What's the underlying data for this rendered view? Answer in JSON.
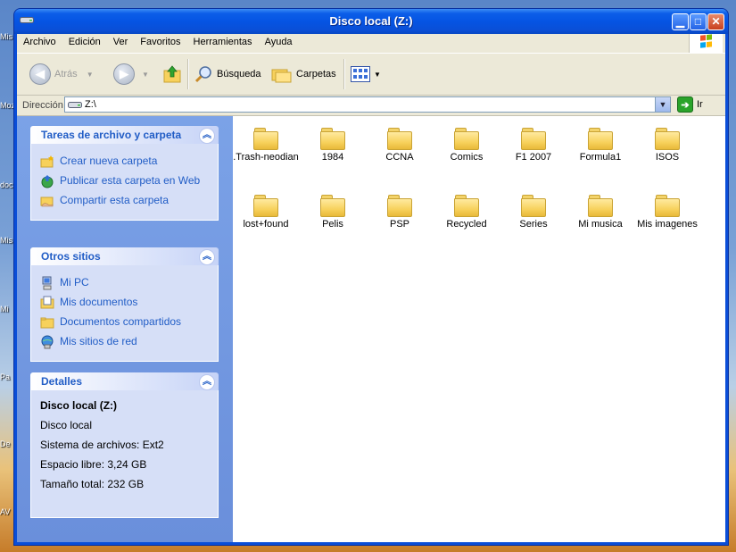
{
  "window": {
    "title": "Disco local (Z:)",
    "minimize": "▁",
    "maximize": "□",
    "close": "✕"
  },
  "desktop_labels": [
    "Mis",
    "Moz",
    "doc",
    "Mis",
    "Mi",
    "Pa",
    "De",
    "AV"
  ],
  "menu": [
    "Archivo",
    "Edición",
    "Ver",
    "Favoritos",
    "Herramientas",
    "Ayuda"
  ],
  "toolbar": {
    "back_label": "Atrás",
    "search_label": "Búsqueda",
    "folders_label": "Carpetas"
  },
  "address": {
    "label": "Dirección",
    "value": "Z:\\",
    "go_label": "Ir"
  },
  "task_panels": {
    "file_tasks": {
      "title": "Tareas de archivo y carpeta",
      "items": [
        "Crear nueva carpeta",
        "Publicar esta carpeta en Web",
        "Compartir esta carpeta"
      ]
    },
    "other_places": {
      "title": "Otros sitios",
      "items": [
        "Mi PC",
        "Mis documentos",
        "Documentos compartidos",
        "Mis sitios de red"
      ]
    },
    "details": {
      "title": "Detalles",
      "name": "Disco local (Z:)",
      "lines": [
        "Disco local",
        "Sistema de archivos: Ext2",
        "Espacio libre: 3,24 GB",
        "Tamaño total: 232 GB"
      ]
    }
  },
  "folders": [
    ".Trash-neodian",
    "1984",
    "CCNA",
    "Comics",
    "F1 2007",
    "Formula1",
    "ISOS",
    "lost+found",
    "Pelis",
    "PSP",
    "Recycled",
    "Series",
    "Mi musica",
    "Mis imagenes"
  ],
  "colors": {
    "titlebar": "#0554e3",
    "taskpane": "#7ba2e7",
    "panel_text": "#215dc6",
    "folder": "#f7d15c"
  }
}
